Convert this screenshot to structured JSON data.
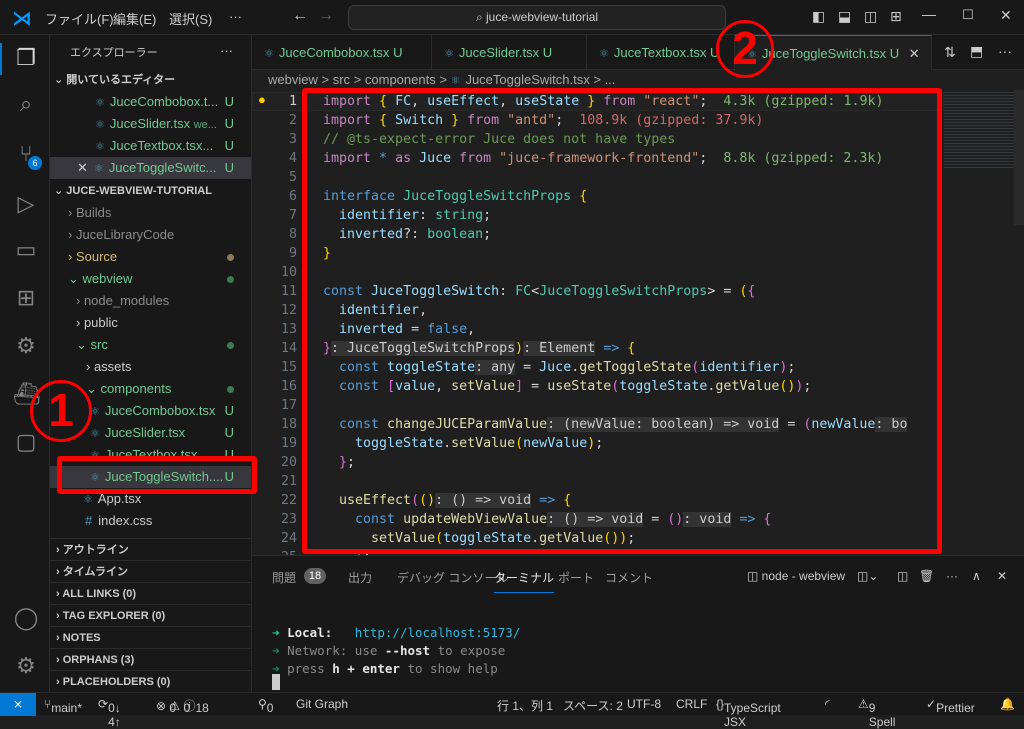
{
  "titlebar": {
    "menus": [
      "ファイル(F)",
      "編集(E)",
      "選択(S)",
      "···"
    ],
    "search": "juce-webview-tutorial"
  },
  "sidebar": {
    "title": "エクスプローラー",
    "open_editors": "開いているエディター",
    "open_files": [
      {
        "name": "JuceCombobox.t...",
        "badge": "U"
      },
      {
        "name": "JuceSlider.tsx",
        "hint": "we...",
        "badge": "U"
      },
      {
        "name": "JuceTextbox.tsx...",
        "badge": "U"
      },
      {
        "name": "JuceToggleSwitc...",
        "badge": "U"
      }
    ],
    "project": "JUCE-WEBVIEW-TUTORIAL",
    "tree": [
      "Builds",
      "JuceLibraryCode",
      "Source",
      "webview",
      "node_modules",
      "public",
      "src",
      "assets",
      "components",
      "JuceCombobox.tsx",
      "JuceSlider.tsx",
      "JuceTextbox.tsx",
      "JuceToggleSwitch....",
      "App.tsx",
      "index.css"
    ],
    "sections": [
      "アウトライン",
      "タイムライン",
      "ALL LINKS (0)",
      "TAG EXPLORER (0)",
      "NOTES",
      "ORPHANS (3)",
      "PLACEHOLDERS (0)"
    ]
  },
  "tabs": [
    {
      "label": "JuceCombobox.tsx",
      "badge": "U"
    },
    {
      "label": "JuceSlider.tsx",
      "badge": "U"
    },
    {
      "label": "JuceTextbox.tsx",
      "badge": "U"
    },
    {
      "label": "JuceToggleSwitch.tsx",
      "badge": "U",
      "active": true
    }
  ],
  "breadcrumb": [
    "webview",
    ">",
    "src",
    ">",
    "components",
    ">",
    "JuceToggleSwitch.tsx",
    ">",
    "..."
  ],
  "code": [
    [
      [
        "import ",
        "kw"
      ],
      [
        "{ ",
        "b"
      ],
      [
        "FC",
        "v"
      ],
      [
        ", ",
        "p"
      ],
      [
        "useEffect",
        "v"
      ],
      [
        ", ",
        "p"
      ],
      [
        "useState ",
        "v"
      ],
      [
        "} ",
        "b"
      ],
      [
        "from ",
        "kw"
      ],
      [
        "\"react\"",
        "s"
      ],
      [
        ";  ",
        "p"
      ],
      [
        "4.3k (gzipped: 1.9k)",
        "g"
      ]
    ],
    [
      [
        "import ",
        "kw"
      ],
      [
        "{ ",
        "b"
      ],
      [
        "Switch ",
        "v"
      ],
      [
        "} ",
        "b"
      ],
      [
        "from ",
        "kw"
      ],
      [
        "\"antd\"",
        "s"
      ],
      [
        ";  ",
        "p"
      ],
      [
        "108.9k (gzipped: 37.9k)",
        "r"
      ]
    ],
    [
      [
        "// @ts-expect-error Juce does not have types",
        "c"
      ]
    ],
    [
      [
        "import ",
        "kw"
      ],
      [
        "* ",
        "kb"
      ],
      [
        "as ",
        "kw"
      ],
      [
        "Juce ",
        "v"
      ],
      [
        "from ",
        "kw"
      ],
      [
        "\"juce-framework-frontend\"",
        "s"
      ],
      [
        ";  ",
        "p"
      ],
      [
        "8.8k (gzipped: 2.3k)",
        "g"
      ]
    ],
    [],
    [
      [
        "interface ",
        "kb"
      ],
      [
        "JuceToggleSwitchProps ",
        "t"
      ],
      [
        "{",
        "b"
      ]
    ],
    [
      [
        "  identifier",
        "v"
      ],
      [
        ": ",
        "p"
      ],
      [
        "string",
        "t"
      ],
      [
        ";",
        "p"
      ]
    ],
    [
      [
        "  inverted",
        "v"
      ],
      [
        "?: ",
        "p"
      ],
      [
        "boolean",
        "t"
      ],
      [
        ";",
        "p"
      ]
    ],
    [
      [
        "}",
        "b"
      ]
    ],
    [],
    [
      [
        "const ",
        "kb"
      ],
      [
        "JuceToggleSwitch",
        "v"
      ],
      [
        ": ",
        "p"
      ],
      [
        "FC",
        "t"
      ],
      [
        "<",
        "p"
      ],
      [
        "JuceToggleSwitchProps",
        "t"
      ],
      [
        "> = ",
        "p"
      ],
      [
        "(",
        "b"
      ],
      [
        "{",
        "b2"
      ]
    ],
    [
      [
        "  identifier",
        "v"
      ],
      [
        ",",
        "p"
      ]
    ],
    [
      [
        "  inverted ",
        "v"
      ],
      [
        "= ",
        "p"
      ],
      [
        "false",
        "kb"
      ],
      [
        ",",
        "p"
      ]
    ],
    [
      [
        "}",
        "b2"
      ],
      [
        ": JuceToggleSwitchProps",
        "h"
      ],
      [
        ")",
        "b"
      ],
      [
        ": Element",
        "h"
      ],
      [
        " => ",
        "kb"
      ],
      [
        "{",
        "b"
      ]
    ],
    [
      [
        "  const ",
        "kb"
      ],
      [
        "toggleState",
        "v"
      ],
      [
        ": any",
        "h"
      ],
      [
        " = ",
        "p"
      ],
      [
        "Juce",
        "v"
      ],
      [
        ".",
        "p"
      ],
      [
        "getToggleState",
        "f"
      ],
      [
        "(",
        "b2"
      ],
      [
        "identifier",
        "v"
      ],
      [
        ")",
        "b2"
      ],
      [
        ";",
        "p"
      ]
    ],
    [
      [
        "  const ",
        "kb"
      ],
      [
        "[",
        "b2"
      ],
      [
        "value",
        "v"
      ],
      [
        ", ",
        "p"
      ],
      [
        "setValue",
        "f"
      ],
      [
        "]",
        "b2"
      ],
      [
        " = ",
        "p"
      ],
      [
        "useState",
        "f"
      ],
      [
        "(",
        "b2"
      ],
      [
        "toggleState",
        "v"
      ],
      [
        ".",
        "p"
      ],
      [
        "getValue",
        "f"
      ],
      [
        "()",
        "b"
      ],
      [
        ")",
        "b2"
      ],
      [
        ";",
        "p"
      ]
    ],
    [],
    [
      [
        "  const ",
        "kb"
      ],
      [
        "changeJUCEParamValue",
        "f"
      ],
      [
        ": (newValue: boolean) => void",
        "h"
      ],
      [
        " = ",
        "p"
      ],
      [
        "(",
        "b2"
      ],
      [
        "newValue",
        "v"
      ],
      [
        ": bo",
        "h"
      ]
    ],
    [
      [
        "    toggleState",
        "v"
      ],
      [
        ".",
        "p"
      ],
      [
        "setValue",
        "f"
      ],
      [
        "(",
        "b"
      ],
      [
        "newValue",
        "v"
      ],
      [
        ")",
        "b"
      ],
      [
        ";",
        "p"
      ]
    ],
    [
      [
        "  }",
        "b2"
      ],
      [
        ";",
        "p"
      ]
    ],
    [],
    [
      [
        "  useEffect",
        "f"
      ],
      [
        "(",
        "b2"
      ],
      [
        "()",
        "b"
      ],
      [
        ": () => void",
        "h"
      ],
      [
        " => ",
        "kb"
      ],
      [
        "{",
        "b"
      ]
    ],
    [
      [
        "    const ",
        "kb"
      ],
      [
        "updateWebViewValue",
        "f"
      ],
      [
        ": () => void",
        "h"
      ],
      [
        " = ",
        "p"
      ],
      [
        "()",
        "b2"
      ],
      [
        ": void",
        "h"
      ],
      [
        " => ",
        "kb"
      ],
      [
        "{",
        "b2"
      ]
    ],
    [
      [
        "      setValue",
        "f"
      ],
      [
        "(",
        "b"
      ],
      [
        "toggleState",
        "v"
      ],
      [
        ".",
        "p"
      ],
      [
        "getValue",
        "f"
      ],
      [
        "()",
        "b"
      ],
      [
        ")",
        "b"
      ],
      [
        ";",
        "p"
      ]
    ],
    [
      [
        "    }",
        "b2"
      ],
      [
        ";",
        "p"
      ]
    ]
  ],
  "panel": {
    "tabs": [
      "問題",
      "出力",
      "デバッグ コンソール",
      "ターミナル",
      "ポート",
      "コメント"
    ],
    "problems_count": "18",
    "terminal_name": "node - webview",
    "lines": [
      [
        [
          "➜ ",
          "t"
        ],
        [
          "Local:   ",
          "pb"
        ],
        [
          "http://localhost:5173/",
          "u"
        ]
      ],
      [
        [
          "➜ ",
          "tg"
        ],
        [
          "Network: use ",
          "d"
        ],
        [
          "--host",
          "pb"
        ],
        [
          " to expose",
          "d"
        ]
      ],
      [
        [
          "➜ ",
          "tg"
        ],
        [
          "press ",
          "d"
        ],
        [
          "h + enter",
          "pb"
        ],
        [
          " to show help",
          "d"
        ]
      ]
    ]
  },
  "status": {
    "branch": "main*",
    "sync": "0↓ 4↑",
    "errors": "0",
    "warnings": "0",
    "info": "18",
    "ports": "0",
    "git_graph": "Git Graph",
    "position": "行 1、列 1",
    "spaces": "スペース: 2",
    "encoding": "UTF-8",
    "eol": "CRLF",
    "language": "TypeScript JSX",
    "spell": "9 Spell",
    "prettier": "Prettier"
  },
  "annotations": [
    "①",
    "②"
  ],
  "colors": {
    "annotation": "#ff0000",
    "accent": "#0078d4",
    "untracked": "#73c991"
  }
}
